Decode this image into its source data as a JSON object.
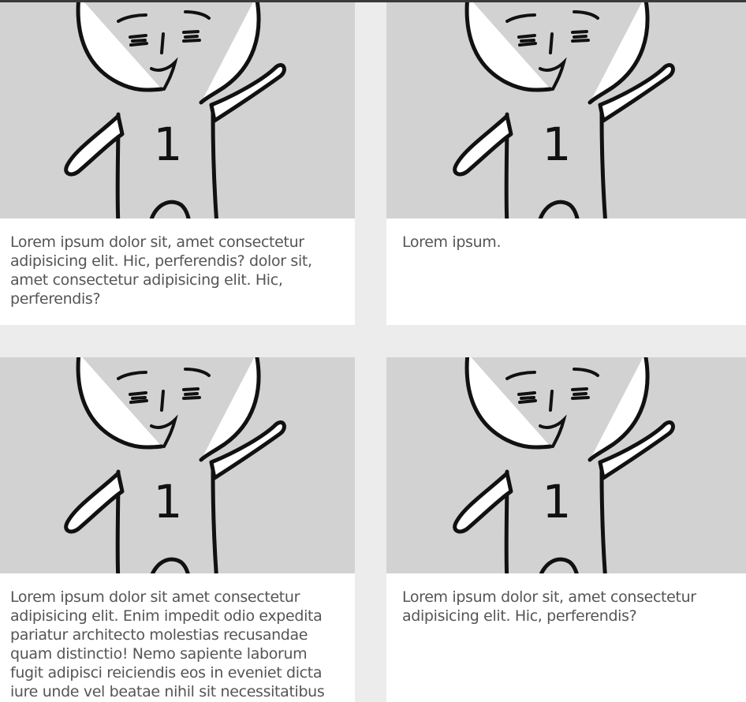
{
  "cards": [
    {
      "image": "cartoon-character-waving",
      "text": "Lorem ipsum dolor sit, amet consectetur adipisicing elit. Hic, perferendis? dolor sit, amet consectetur adipisicing elit. Hic, perferendis?"
    },
    {
      "image": "cartoon-character-waving",
      "text": "Lorem ipsum."
    },
    {
      "image": "cartoon-character-waving",
      "text": "Lorem ipsum dolor sit amet consectetur adipisicing elit. Enim impedit odio expedita pariatur architecto molestias recusandae quam distinctio! Nemo sapiente laborum fugit adipisci reiciendis eos in eveniet dicta iure unde vel beatae nihil sit necessitatibus"
    },
    {
      "image": "cartoon-character-waving",
      "text": "Lorem ipsum dolor sit, amet consectetur adipisicing elit. Hic, perferendis?"
    }
  ],
  "illustration": {
    "chest_number": "1"
  },
  "colors": {
    "page_background": "#ececec",
    "card_background": "#ffffff",
    "image_background": "#d2d2d2",
    "text": "#555555",
    "top_bar": "#3a3a3a"
  }
}
